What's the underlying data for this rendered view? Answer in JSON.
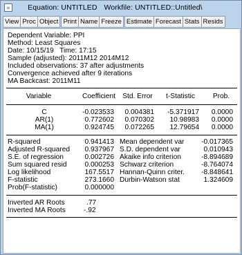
{
  "window": {
    "title": "Equation: UNTITLED",
    "workfile": "Workfile: UNTITLED::Untitled\\"
  },
  "toolbar": {
    "buttons": [
      "View",
      "Proc",
      "Object",
      "Print",
      "Name",
      "Freeze",
      "Estimate",
      "Forecast",
      "Stats",
      "Resids"
    ]
  },
  "header": {
    "lines": [
      "Dependent Variable: PPI",
      "Method: Least Squares",
      "Date: 10/15/19   Time: 17:15",
      "Sample (adjusted): 2011M12 2014M12",
      "Included observations: 37 after adjustments",
      "Convergence achieved after 9 iterations",
      "MA Backcast: 2011M11"
    ]
  },
  "coef_table": {
    "columns": [
      "Variable",
      "Coefficient",
      "Std. Error",
      "t-Statistic",
      "Prob."
    ],
    "rows": [
      [
        "C",
        "-0.023533",
        "0.004381",
        "-5.371917",
        "0.0000"
      ],
      [
        "AR(1)",
        "0.772602",
        "0.070302",
        "10.98983",
        "0.0000"
      ],
      [
        "MA(1)",
        "0.924745",
        "0.072265",
        "12.79654",
        "0.0000"
      ]
    ]
  },
  "stats_table": {
    "rows": [
      [
        "R-squared",
        "0.941413",
        "Mean dependent var",
        "-0.017365"
      ],
      [
        "Adjusted R-squared",
        "0.937967",
        "S.D. dependent var",
        "0.010943"
      ],
      [
        "S.E. of regression",
        "0.002726",
        "Akaike info criterion",
        "-8.894689"
      ],
      [
        "Sum squared resid",
        "0.000253",
        "Schwarz criterion",
        "-8.764074"
      ],
      [
        "Log likelihood",
        "167.5517",
        "Hannan-Quinn criter.",
        "-8.848641"
      ],
      [
        "F-statistic",
        "273.1660",
        "Durbin-Watson stat",
        "1.324609"
      ],
      [
        "Prob(F-statistic)",
        "0.000000",
        "",
        ""
      ]
    ]
  },
  "roots_table": {
    "rows": [
      [
        "Inverted AR Roots",
        ".77"
      ],
      [
        "Inverted MA Roots",
        "-.92"
      ]
    ]
  }
}
